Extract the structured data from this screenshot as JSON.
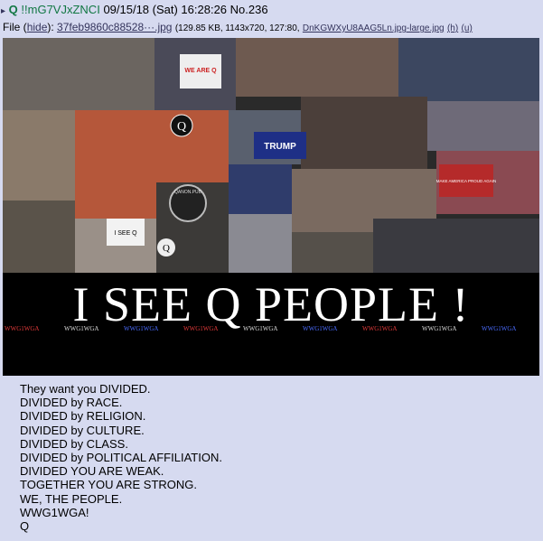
{
  "post": {
    "arrow": "▸",
    "name": "Q",
    "tripcode": "!!mG7VJxZNCI",
    "date": "09/15/18 (Sat) 16:28:26",
    "number": "No.236"
  },
  "file": {
    "label": "File",
    "hide_link": "hide",
    "filename": "37feb9860c88528···.jpg",
    "info": "(129.85 KB, 1143x720, 127:80,",
    "orig_name": "DnKGWXyU8AAG5Ln.jpg-large.jpg",
    "h_link": "(h)",
    "u_link": "(u)"
  },
  "image": {
    "banner_text": "I SEE Q PEOPLE !",
    "tag_text": "WWG1WGA",
    "tag_colors": [
      "#e23a3a",
      "#dddddd",
      "#4a6cff",
      "#e23a3a",
      "#dddddd",
      "#4a6cff",
      "#e23a3a",
      "#dddddd",
      "#4a6cff"
    ],
    "signs": [
      "WE ARE Q",
      "TRUMP",
      "Q",
      "I SEE Q",
      "MAKE AMERICA PROUD AGAIN",
      "QANON.PUB",
      "Q"
    ]
  },
  "message": [
    "They want you DIVIDED.",
    "DIVIDED by RACE.",
    "DIVIDED by RELIGION.",
    "DIVIDED by CULTURE.",
    "DIVIDED by CLASS.",
    "DIVIDED by POLITICAL AFFILIATION.",
    "DIVIDED YOU ARE WEAK.",
    "TOGETHER YOU ARE STRONG.",
    "WE, THE PEOPLE.",
    "WWG1WGA!",
    "Q"
  ],
  "colors": {
    "background": "#d6daf0",
    "name": "#117743",
    "link": "#34345c"
  }
}
